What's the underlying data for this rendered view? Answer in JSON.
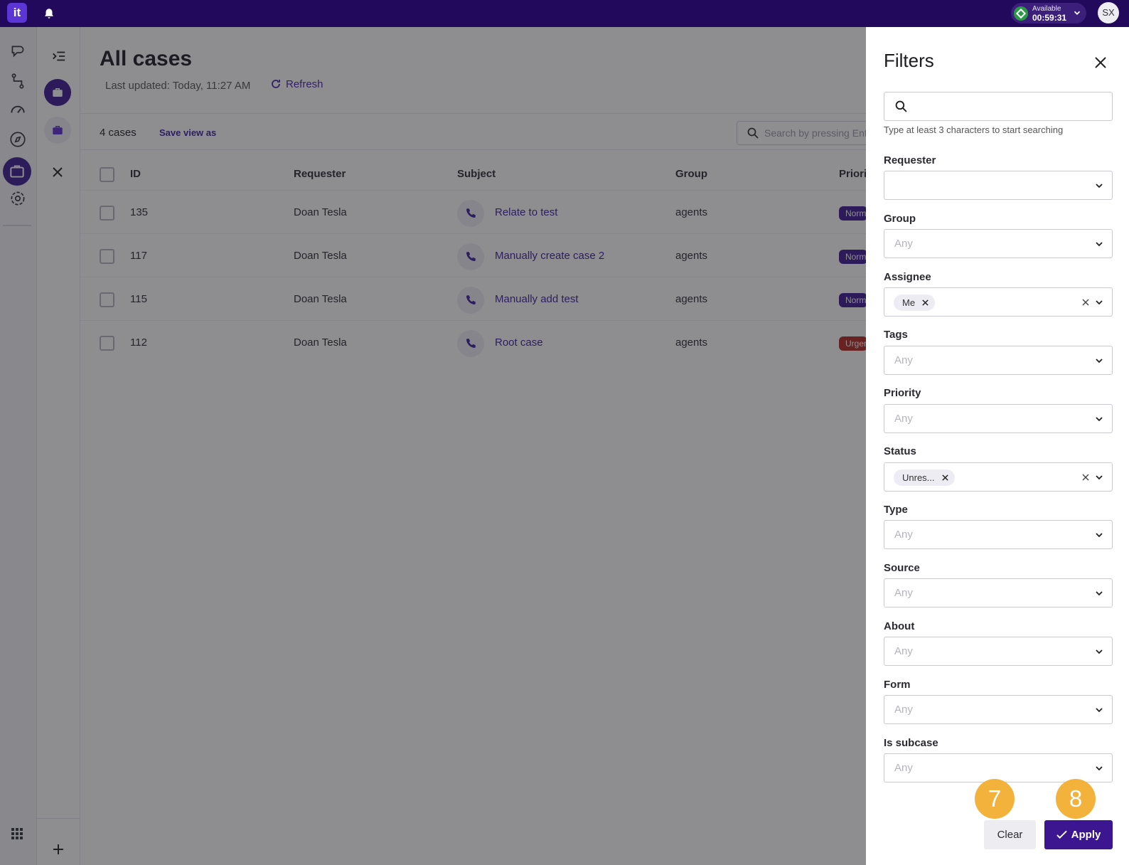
{
  "topbar": {
    "logo": "it",
    "status_label": "Available",
    "status_timer": "00:59:31",
    "avatar_initials": "SX"
  },
  "page": {
    "title": "All cases",
    "last_updated": "Last updated:  Today, 11:27 AM",
    "refresh_label": "Refresh",
    "case_count": "4 cases",
    "save_view_label": "Save view as",
    "search_placeholder": "Search by pressing Enter"
  },
  "table": {
    "headers": {
      "id": "ID",
      "requester": "Requester",
      "subject": "Subject",
      "group": "Group",
      "priority": "Priority"
    },
    "rows": [
      {
        "id": "135",
        "requester": "Doan Tesla",
        "subject": "Relate to test",
        "group": "agents",
        "priority": "Normal",
        "priority_color": "#3c1690"
      },
      {
        "id": "117",
        "requester": "Doan Tesla",
        "subject": "Manually create case 2",
        "group": "agents",
        "priority": "Normal",
        "priority_color": "#3c1690"
      },
      {
        "id": "115",
        "requester": "Doan Tesla",
        "subject": "Manually add test",
        "group": "agents",
        "priority": "Normal",
        "priority_color": "#3c1690"
      },
      {
        "id": "112",
        "requester": "Doan Tesla",
        "subject": "Root case",
        "group": "agents",
        "priority": "Urgent",
        "priority_color": "#b3261e"
      }
    ]
  },
  "filters": {
    "title": "Filters",
    "search_hint": "Type at least 3 characters to start searching",
    "requester": {
      "label": "Requester",
      "value": ""
    },
    "group": {
      "label": "Group",
      "placeholder": "Any"
    },
    "assignee": {
      "label": "Assignee",
      "chip": "Me"
    },
    "tags": {
      "label": "Tags",
      "placeholder": "Any"
    },
    "priority": {
      "label": "Priority",
      "placeholder": "Any"
    },
    "status": {
      "label": "Status",
      "chip": "Unres..."
    },
    "type": {
      "label": "Type",
      "placeholder": "Any"
    },
    "source": {
      "label": "Source",
      "placeholder": "Any"
    },
    "about": {
      "label": "About",
      "placeholder": "Any"
    },
    "form": {
      "label": "Form",
      "placeholder": "Any"
    },
    "is_subcase": {
      "label": "Is subcase",
      "placeholder": "Any"
    },
    "clear_label": "Clear",
    "apply_label": "Apply"
  },
  "annotations": {
    "marker_clear": "7",
    "marker_apply": "8"
  },
  "colors": {
    "brand_dark": "#22095b",
    "accent": "#3c1690",
    "link": "#3b1d9a",
    "marker": "#f2b23b",
    "urgent": "#b3261e"
  }
}
